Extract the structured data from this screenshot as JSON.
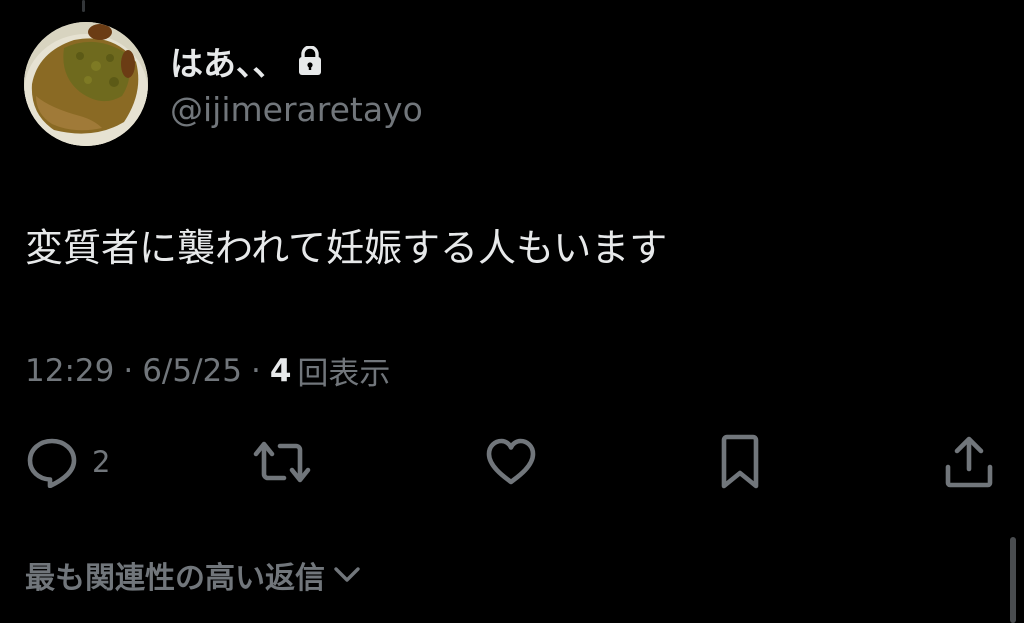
{
  "author": {
    "display_name": "はあ、、",
    "handle": "@ijimeraretayo",
    "protected": true,
    "avatar": "curry-rice-photo"
  },
  "tweet": {
    "text": "変質者に襲われて妊娠する人もいます",
    "time": "12:29",
    "separator": "·",
    "date": "6/5/25",
    "views_count": "4",
    "views_label": "回表示"
  },
  "actions": {
    "reply_icon": "reply-icon",
    "reply_count": "2",
    "retweet_icon": "retweet-icon",
    "like_icon": "heart-icon",
    "bookmark_icon": "bookmark-icon",
    "share_icon": "share-icon"
  },
  "replies_filter": {
    "label": "最も関連性の高い返信",
    "icon": "chevron-down-icon"
  },
  "colors": {
    "background": "#000000",
    "primary_text": "#e7e9ea",
    "secondary_text": "#71767b"
  }
}
